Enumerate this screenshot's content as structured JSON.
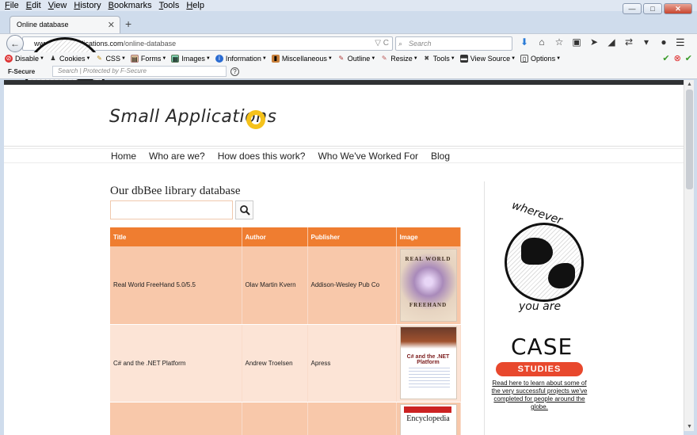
{
  "menubar": {
    "items": [
      "File",
      "Edit",
      "View",
      "History",
      "Bookmarks",
      "Tools",
      "Help"
    ]
  },
  "window_buttons": {
    "minimize": "—",
    "maximize": "□",
    "close": "✕"
  },
  "tab": {
    "title": "Online database",
    "close": "✕",
    "new": "+"
  },
  "navbar": {
    "back": "←",
    "url_domain": "www.small-applications.com",
    "url_path": "/online-database",
    "url_controls": "▽ C",
    "search_placeholder": "Search",
    "icons": [
      "download-icon",
      "home-icon",
      "bookmark-star-icon",
      "reading-list-icon",
      "send-icon",
      "arrow-icon",
      "shuffle-icon",
      "dropdown-icon",
      "chat-icon"
    ]
  },
  "addons": {
    "items": [
      "Disable",
      "Cookies",
      "CSS",
      "Forms",
      "Images",
      "Information",
      "Miscellaneous",
      "Outline",
      "Resize",
      "Tools",
      "View Source",
      "Options"
    ]
  },
  "fsecure": {
    "logo": "F-Secure",
    "search_placeholder": "Search | Protected by F-Secure",
    "help": "?"
  },
  "page": {
    "logo_text": "Small Applications",
    "nav": [
      "Home",
      "Who are we?",
      "How does this work?",
      "Who We've Worked For",
      "Blog"
    ],
    "heading": "Our dbBee library database",
    "table": {
      "headers": [
        "Title",
        "Author",
        "Publisher",
        "Image"
      ],
      "rows": [
        {
          "title": "Real World FreeHand 5.0/5.5",
          "author": "Olav Martin Kvern",
          "publisher": "Addison-Wesley Pub Co",
          "cover_top": "REAL WORLD",
          "cover_bottom": "FREEHAND"
        },
        {
          "title": "C# and the .NET Platform",
          "author": "Andrew Troelsen",
          "publisher": "Apress",
          "cover_top": "C# and the .NET Platform",
          "cover_bottom": ""
        },
        {
          "title": "",
          "author": "",
          "publisher": "",
          "cover_top": "Encyclopedia",
          "cover_bottom": ""
        }
      ]
    },
    "sidebar": {
      "wherever": "wherever",
      "you_are": "you are",
      "case": "CASE",
      "studies": "STUDIES",
      "case_link": "Read here to learn about some of the very successful projects we've completed for people around the globe."
    }
  }
}
